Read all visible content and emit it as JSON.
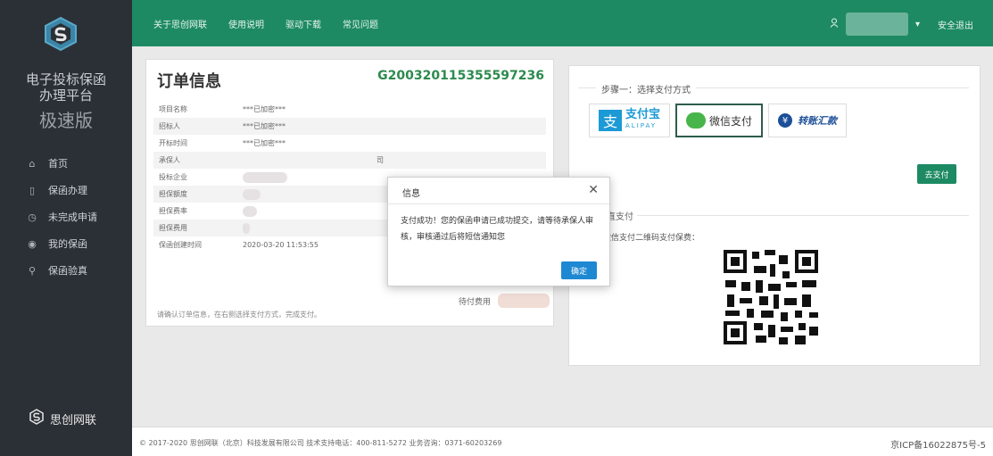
{
  "sidebar": {
    "brand_line1": "电子投标保函",
    "brand_line2": "办理平台",
    "brand_line3": "极速版",
    "items": [
      {
        "icon": "home-icon",
        "label": "首页"
      },
      {
        "icon": "document-icon",
        "label": "保函办理"
      },
      {
        "icon": "clock-icon",
        "label": "未完成申请"
      },
      {
        "icon": "stack-icon",
        "label": "我的保函"
      },
      {
        "icon": "search-icon",
        "label": "保函验真"
      }
    ],
    "bottom_brand": "思创网联"
  },
  "topbar": {
    "nav": [
      "关于思创网联",
      "使用说明",
      "驱动下载",
      "常见问题"
    ],
    "logout": "安全退出"
  },
  "order": {
    "title": "订单信息",
    "order_no": "G200320115355597236",
    "rows": [
      {
        "label": "项目名称",
        "value": "***已加密***"
      },
      {
        "label": "招标人",
        "value": "***已加密***"
      },
      {
        "label": "开标时间",
        "value": "***已加密***"
      },
      {
        "label": "承保人",
        "value": "司"
      },
      {
        "label": "投标企业",
        "value": ""
      },
      {
        "label": "担保额度",
        "value": ""
      },
      {
        "label": "担保费率",
        "value": ""
      },
      {
        "label": "担保费用",
        "value": ""
      },
      {
        "label": "保函创建时间",
        "value": "2020-03-20 11:53:55"
      }
    ],
    "pending_label": "待付费用",
    "footer_text": "请确认订单信息，在右侧选择支付方式，完成支付。"
  },
  "payment": {
    "step1": "步骤一：选择支付方式",
    "alipay_cn": "支付宝",
    "alipay_en": "ALIPAY",
    "wechat": "微信支付",
    "bank": "转账汇款",
    "go_pay": "去支付",
    "section2_title": "直支付",
    "scan_text": "微信支付二维码支付保费："
  },
  "modal": {
    "title": "信息",
    "message": "支付成功！您的保函申请已成功提交，请等待承保人审核，审核通过后将短信通知您",
    "ok": "确定"
  },
  "footer": {
    "left": "© 2017-2020 思创网联（北京）科技发展有限公司 技术支持电话：400-811-5272 业务咨询：0371-60203269",
    "right": "京ICP备16022875号-5"
  },
  "colors": {
    "topbar": "#1d8a64",
    "sidebar": "#2b3036",
    "primary_button": "#1e88d2"
  }
}
